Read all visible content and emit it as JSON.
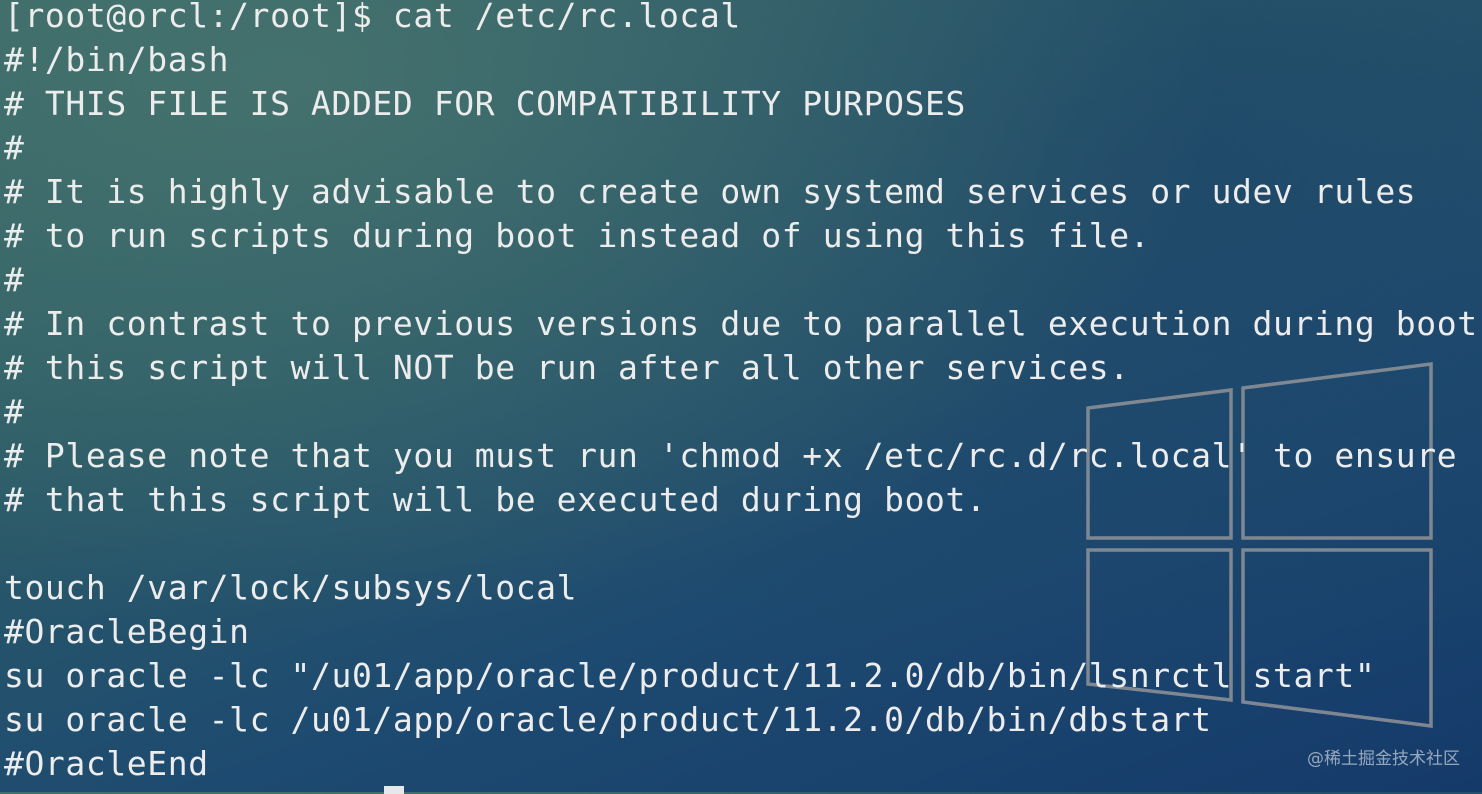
{
  "terminal": {
    "lines": [
      "[root@orcl:/root]$ cat /etc/rc.local",
      "#!/bin/bash",
      "# THIS FILE IS ADDED FOR COMPATIBILITY PURPOSES",
      "#",
      "# It is highly advisable to create own systemd services or udev rules",
      "# to run scripts during boot instead of using this file.",
      "#",
      "# In contrast to previous versions due to parallel execution during boot",
      "# this script will NOT be run after all other services.",
      "#",
      "# Please note that you must run 'chmod +x /etc/rc.d/rc.local' to ensure",
      "# that this script will be executed during boot.",
      "",
      "touch /var/lock/subsys/local",
      "#OracleBegin",
      "su oracle -lc \"/u01/app/oracle/product/11.2.0/db/bin/lsnrctl start\"",
      "su oracle -lc /u01/app/oracle/product/11.2.0/db/bin/dbstart",
      "#OracleEnd"
    ]
  },
  "watermark": {
    "text": "@稀土掘金技术社区"
  },
  "colors": {
    "text": "#ececec",
    "background": "#2a5a68",
    "logo_outline": "#8a8f96"
  },
  "icons": {
    "background_logo": "windows-logo-icon"
  }
}
